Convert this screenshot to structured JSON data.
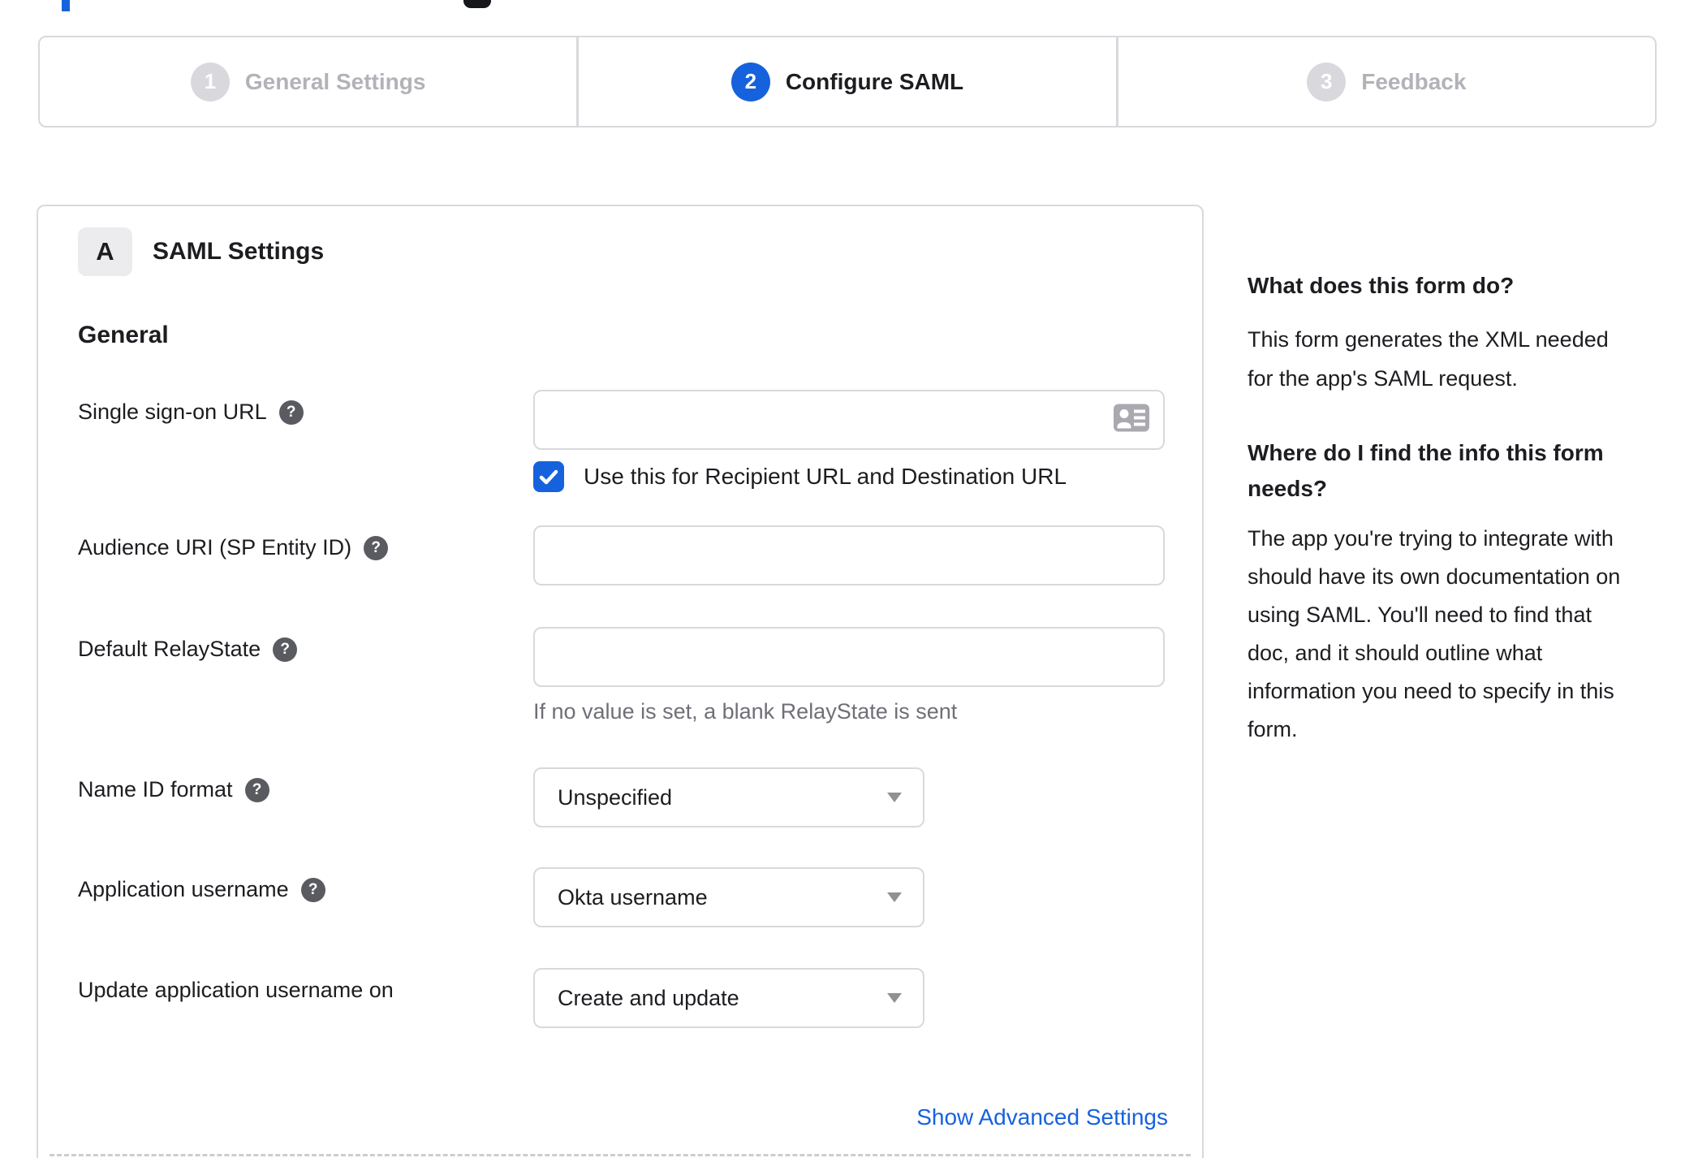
{
  "colors": {
    "accent_blue": "#1662dd",
    "border_gray": "#d9d9dd",
    "inactive_gray": "#b2b2b8",
    "text_dark": "#1d1d21",
    "hint_gray": "#6f6f78"
  },
  "stepper": {
    "steps": [
      {
        "number": "1",
        "label": "General Settings",
        "state": "inactive"
      },
      {
        "number": "2",
        "label": "Configure SAML",
        "state": "active"
      },
      {
        "number": "3",
        "label": "Feedback",
        "state": "inactive"
      }
    ]
  },
  "panel": {
    "badge": "A",
    "title": "SAML Settings",
    "section_heading": "General"
  },
  "form": {
    "sso": {
      "label": "Single sign-on URL",
      "value": "",
      "checkbox_checked": true,
      "checkbox_label": "Use this for Recipient URL and Destination URL"
    },
    "audience": {
      "label": "Audience URI (SP Entity ID)",
      "value": ""
    },
    "relay": {
      "label": "Default RelayState",
      "value": "",
      "hint": "If no value is set, a blank RelayState is sent"
    },
    "name_id": {
      "label": "Name ID format",
      "value": "Unspecified"
    },
    "app_username": {
      "label": "Application username",
      "value": "Okta username"
    },
    "update_username": {
      "label": "Update application username on",
      "value": "Create and update"
    },
    "advanced_link": "Show Advanced Settings"
  },
  "icons": {
    "help_glyph": "?"
  },
  "sidebar": {
    "h1": "What does this form do?",
    "p1": [
      "This form generates the XML needed",
      "for the app's SAML request."
    ],
    "h2": [
      "Where do I find the info this form",
      "needs?"
    ],
    "p2": [
      "The app you're trying to integrate with",
      "should have its own documentation on",
      "using SAML. You'll need to find that",
      "doc, and it should outline what",
      "information you need to specify in this",
      "form."
    ]
  }
}
